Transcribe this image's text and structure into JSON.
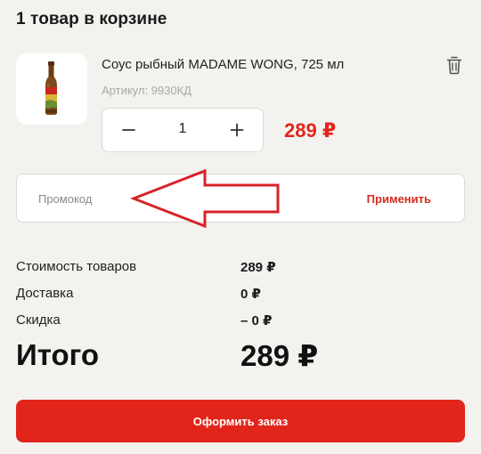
{
  "cart": {
    "title": "1 товар в корзине"
  },
  "product": {
    "name": "Соус рыбный MADAME WONG, 725 мл",
    "sku": "Артикул: 9930КД",
    "quantity": "1",
    "price": "289 ₽",
    "icons": {
      "thumbnail": "fish-sauce-bottle",
      "remove": "trash-icon",
      "decrease": "minus-icon",
      "increase": "plus-icon"
    }
  },
  "promo": {
    "placeholder": "Промокод",
    "value": "",
    "apply_label": "Применить"
  },
  "summary": {
    "goods_label": "Стоимость товаров",
    "goods_value": "289 ₽",
    "delivery_label": "Доставка",
    "delivery_value": "0 ₽",
    "discount_label": "Скидка",
    "discount_value": "– 0 ₽",
    "total_label": "Итого",
    "total_value": "289 ₽"
  },
  "checkout": {
    "label": "Оформить заказ"
  },
  "colors": {
    "accent": "#e1251b",
    "background": "#f3f2ef",
    "annotation_arrow": "#d8232a"
  }
}
